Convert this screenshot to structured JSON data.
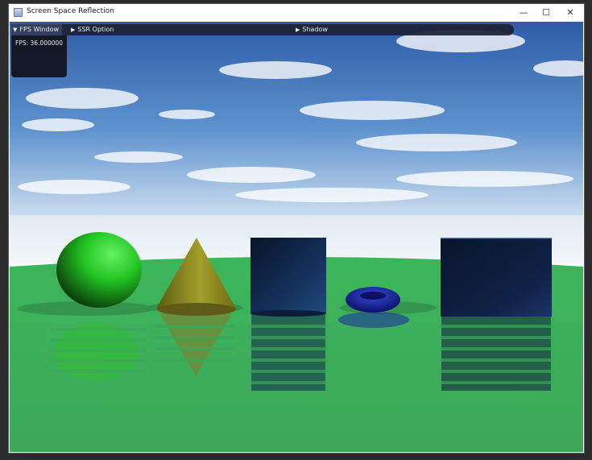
{
  "window": {
    "title": "Screen Space Reflection",
    "minimize_glyph": "—",
    "maximize_glyph": "☐",
    "close_glyph": "✕"
  },
  "menubar": {
    "items": [
      {
        "label": "FPS Window",
        "icon": "triangle-down-icon",
        "glyph": "▼",
        "expanded": true
      },
      {
        "label": "SSR Option",
        "icon": "triangle-right-icon",
        "glyph": "▶",
        "expanded": false
      },
      {
        "label": "Shadow",
        "icon": "triangle-right-icon",
        "glyph": "▶",
        "expanded": false
      }
    ]
  },
  "fps_panel": {
    "text": "FPS: 36.000000"
  },
  "scene": {
    "objects": [
      "sphere",
      "cone",
      "cylinder",
      "torus",
      "cube"
    ],
    "colors": {
      "sky_top": "#2f5fa8",
      "ground": "#3fae5a",
      "sphere": "#22c422",
      "cone": "#8c8a1c",
      "cylinder": "#0e1f3a",
      "torus": "#16209a",
      "cube": "#0a1530"
    }
  }
}
